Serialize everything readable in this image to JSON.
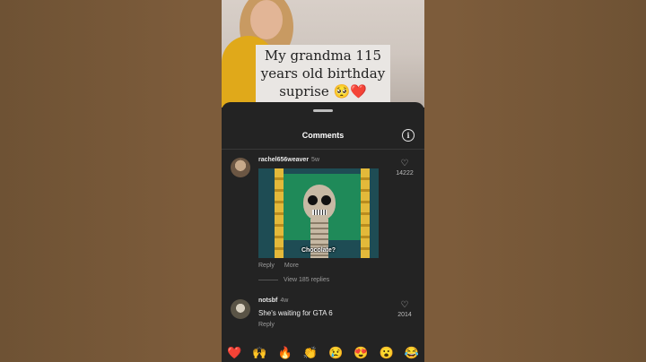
{
  "video": {
    "caption_line1": "My grandma 115",
    "caption_line2": "years old birthday",
    "caption_line3": "suprise 🥺❤️"
  },
  "sheet": {
    "title": "Comments",
    "info_icon": "info-icon"
  },
  "comments": [
    {
      "username": "rachel656weaver",
      "age": "5w",
      "gif_caption": "Chocolate?",
      "actions": [
        "Reply",
        "More"
      ],
      "likes": "14222",
      "view_replies": "View 185 replies"
    },
    {
      "username": "notsbf",
      "age": "4w",
      "text": "She's waiting for GTA 6",
      "actions": [
        "Reply"
      ],
      "likes": "2014"
    }
  ],
  "emoji_bar": [
    "❤️",
    "🙌",
    "🔥",
    "👏",
    "😢",
    "😍",
    "😮",
    "😂"
  ]
}
